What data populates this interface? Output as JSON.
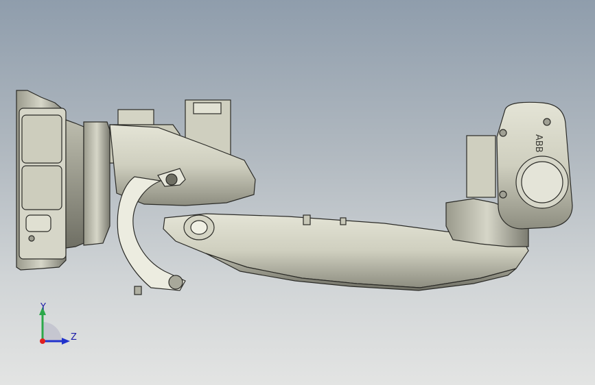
{
  "viewer": {
    "background_top": "#8f9dac",
    "background_bottom": "#e3e4e3",
    "model_fill": "#d8d8c8",
    "model_edge": "#2a2a26"
  },
  "model": {
    "brand_label": "ABB"
  },
  "triad": {
    "y_label": "Y",
    "z_label": "Z",
    "y_color": "#2ca84a",
    "z_color": "#2233cc",
    "x_color": "#e02020"
  }
}
